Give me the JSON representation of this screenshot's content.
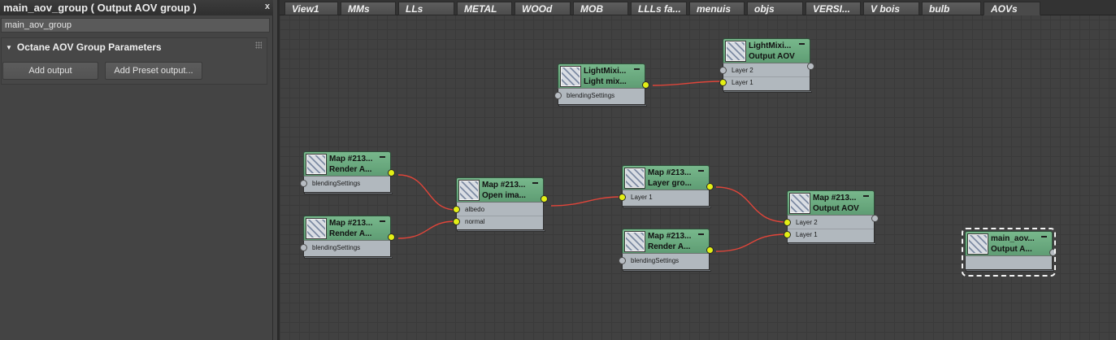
{
  "panel": {
    "title": "main_aov_group  ( Output AOV group )",
    "close": "x",
    "name_value": "main_aov_group",
    "rollout_title": "Octane AOV Group Parameters",
    "add_output": "Add output",
    "add_preset_output": "Add Preset output..."
  },
  "tabs": [
    "View1",
    "MMs",
    "LLs",
    "METAL",
    "WOOd",
    "MOB",
    "LLLs fa...",
    "menuis",
    "objs",
    "VERSI...",
    "V bois",
    "bulb",
    "AOVs"
  ],
  "active_tab": "AOVs",
  "nodes": {
    "lightmix_light": {
      "line1": "LightMixi...",
      "line2": "Light mix...",
      "inputs": [
        "blendingSettings"
      ]
    },
    "lightmix_output": {
      "line1": "LightMixi...",
      "line2": "Output AOV",
      "inputs": [
        "Layer 2",
        "Layer 1"
      ]
    },
    "render_a1": {
      "line1": "Map #213...",
      "line2": "Render A...",
      "inputs": [
        "blendingSettings"
      ]
    },
    "render_a2": {
      "line1": "Map #213...",
      "line2": "Render A...",
      "inputs": [
        "blendingSettings"
      ]
    },
    "open_image": {
      "line1": "Map #213...",
      "line2": "Open ima...",
      "inputs": [
        "albedo",
        "normal"
      ]
    },
    "layer_group": {
      "line1": "Map #213...",
      "line2": "Layer gro...",
      "inputs": [
        "Layer 1"
      ]
    },
    "render_a3": {
      "line1": "Map #213...",
      "line2": "Render A...",
      "inputs": [
        "blendingSettings"
      ]
    },
    "output_aov": {
      "line1": "Map #213...",
      "line2": "Output AOV",
      "inputs": [
        "Layer 2",
        "Layer 1"
      ]
    },
    "main_aov": {
      "line1": "main_aov...",
      "line2": "Output A...",
      "inputs": []
    }
  },
  "colors": {
    "node_header": "#6aa87e",
    "wire": "#e0453a",
    "pin_connected": "#e3ef15",
    "pin_unconnected": "#b7bcc2"
  }
}
